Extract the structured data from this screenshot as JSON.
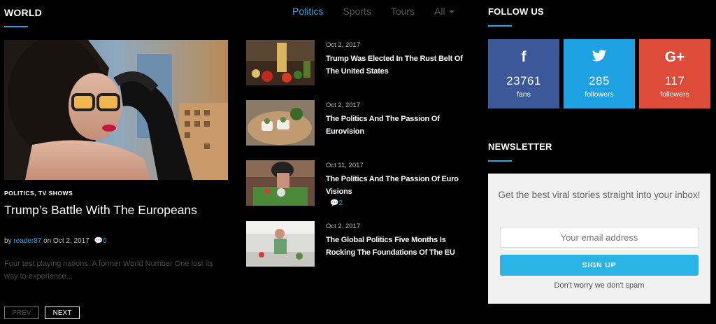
{
  "section": {
    "title": "WORLD"
  },
  "tabs": [
    {
      "label": "Politics",
      "active": true
    },
    {
      "label": "Sports",
      "active": false
    },
    {
      "label": "Tours",
      "active": false
    },
    {
      "label": "All",
      "active": false
    }
  ],
  "featured": {
    "categories": "POLITICS, TV SHOWS",
    "title": "Trump’s Battle With The Europeans",
    "by": "by",
    "author": "reader87",
    "on": "on Oct 2, 2017",
    "comments": "0",
    "excerpt": "Four test playing nations. A former World Number One lost its way to experience..."
  },
  "pagination": {
    "prev": "PREV",
    "next": "NEXT"
  },
  "posts": [
    {
      "date": "Oct 2, 2017",
      "title": "Trump Was Elected In The Rust Belt Of The United States",
      "comments": ""
    },
    {
      "date": "Oct 2, 2017",
      "title": "The Politics And The Passion Of Eurovision",
      "comments": ""
    },
    {
      "date": "Oct 11, 2017",
      "title": "The Politics And The Passion Of Euro Visions",
      "comments": "2"
    },
    {
      "date": "Oct 2, 2017",
      "title": "The Global Politics Five Months Is Rocking The Foundations Of The EU",
      "comments": ""
    }
  ],
  "follow": {
    "title": "FOLLOW US",
    "networks": [
      {
        "icon": "facebook-icon",
        "glyph": "f",
        "count": "23761",
        "label": "fans",
        "color": "#3b5998"
      },
      {
        "icon": "twitter-icon",
        "glyph": "🐦",
        "count": "285",
        "label": "followers",
        "color": "#1da1e2"
      },
      {
        "icon": "google-plus-icon",
        "glyph": "G+",
        "count": "117",
        "label": "followers",
        "color": "#dd4b39"
      }
    ]
  },
  "newsletter": {
    "title": "NEWSLETTER",
    "text": "Get the best viral stories straight into your inbox!",
    "placeholder": "Your email address",
    "button": "SIGN UP",
    "note": "Don't worry we don't spam"
  },
  "colors": {
    "accent": "#2aa3df",
    "background": "#000000"
  }
}
